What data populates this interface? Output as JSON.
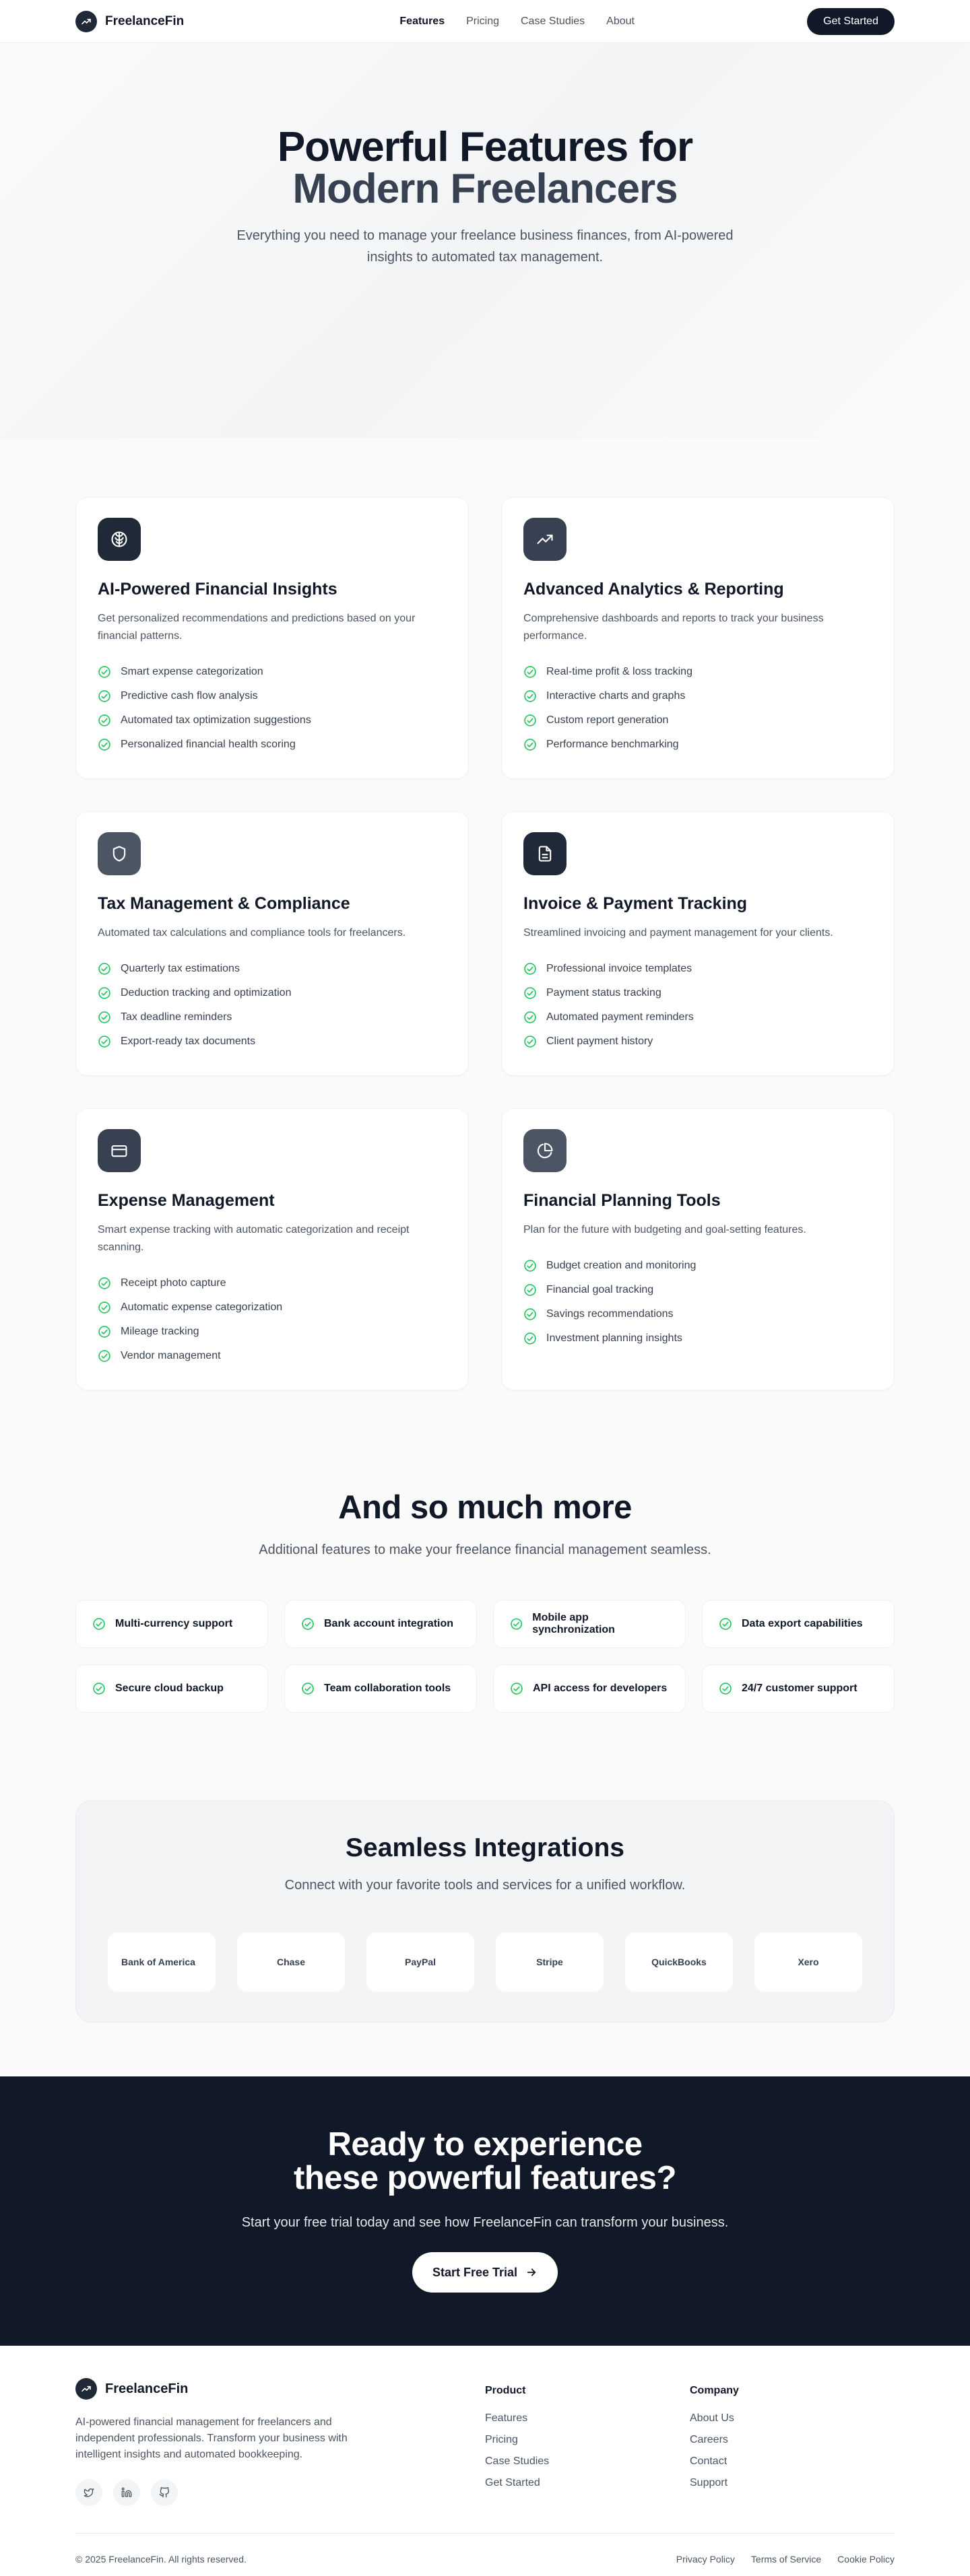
{
  "nav": {
    "brand": "FreelanceFin",
    "links": [
      "Features",
      "Pricing",
      "Case Studies",
      "About"
    ],
    "cta": "Get Started"
  },
  "hero": {
    "title_line1": "Powerful Features for",
    "title_line2": "Modern Freelancers",
    "subtitle": "Everything you need to manage your freelance business finances, from AI-powered insights to automated tax management."
  },
  "features": [
    {
      "icon": "brain-icon",
      "title": "AI-Powered Financial Insights",
      "description": "Get personalized recommendations and predictions based on your financial patterns.",
      "items": [
        "Smart expense categorization",
        "Predictive cash flow analysis",
        "Automated tax optimization suggestions",
        "Personalized financial health scoring"
      ]
    },
    {
      "icon": "trending-up-icon",
      "title": "Advanced Analytics & Reporting",
      "description": "Comprehensive dashboards and reports to track your business performance.",
      "items": [
        "Real-time profit & loss tracking",
        "Interactive charts and graphs",
        "Custom report generation",
        "Performance benchmarking"
      ]
    },
    {
      "icon": "shield-icon",
      "title": "Tax Management & Compliance",
      "description": "Automated tax calculations and compliance tools for freelancers.",
      "items": [
        "Quarterly tax estimations",
        "Deduction tracking and optimization",
        "Tax deadline reminders",
        "Export-ready tax documents"
      ]
    },
    {
      "icon": "document-icon",
      "title": "Invoice & Payment Tracking",
      "description": "Streamlined invoicing and payment management for your clients.",
      "items": [
        "Professional invoice templates",
        "Payment status tracking",
        "Automated payment reminders",
        "Client payment history"
      ]
    },
    {
      "icon": "credit-card-icon",
      "title": "Expense Management",
      "description": "Smart expense tracking with automatic categorization and receipt scanning.",
      "items": [
        "Receipt photo capture",
        "Automatic expense categorization",
        "Mileage tracking",
        "Vendor management"
      ]
    },
    {
      "icon": "pie-chart-icon",
      "title": "Financial Planning Tools",
      "description": "Plan for the future with budgeting and goal-setting features.",
      "items": [
        "Budget creation and monitoring",
        "Financial goal tracking",
        "Savings recommendations",
        "Investment planning insights"
      ]
    }
  ],
  "more": {
    "title": "And so much more",
    "subtitle": "Additional features to make your freelance financial management seamless.",
    "items": [
      "Multi-currency support",
      "Bank account integration",
      "Mobile app synchronization",
      "Data export capabilities",
      "Secure cloud backup",
      "Team collaboration tools",
      "API access for developers",
      "24/7 customer support"
    ]
  },
  "integrations": {
    "title": "Seamless Integrations",
    "subtitle": "Connect with your favorite tools and services for a unified workflow.",
    "logos": [
      "Bank of America",
      "Chase",
      "PayPal",
      "Stripe",
      "QuickBooks",
      "Xero"
    ]
  },
  "cta": {
    "title_line1": "Ready to experience",
    "title_line2": "these powerful features?",
    "subtitle": "Start your free trial today and see how FreelanceFin can transform your business.",
    "button": "Start Free Trial"
  },
  "footer": {
    "brand": "FreelanceFin",
    "description": "AI-powered financial management for freelancers and independent professionals. Transform your business with intelligent insights and automated bookkeeping.",
    "socials": [
      "twitter-icon",
      "linkedin-icon",
      "github-icon"
    ],
    "product_heading": "Product",
    "product_links": [
      "Features",
      "Pricing",
      "Case Studies",
      "Get Started"
    ],
    "company_heading": "Company",
    "company_links": [
      "About Us",
      "Careers",
      "Contact",
      "Support"
    ],
    "copyright": "© 2025 FreelanceFin. All rights reserved.",
    "legal": [
      "Privacy Policy",
      "Terms of Service",
      "Cookie Policy"
    ]
  },
  "colors": {
    "icon_tiles": [
      "#1f2937",
      "#374151",
      "#4b5563",
      "#1f2937",
      "#374151",
      "#4b5563"
    ],
    "check": "#22c55e",
    "dark": "#111827"
  }
}
